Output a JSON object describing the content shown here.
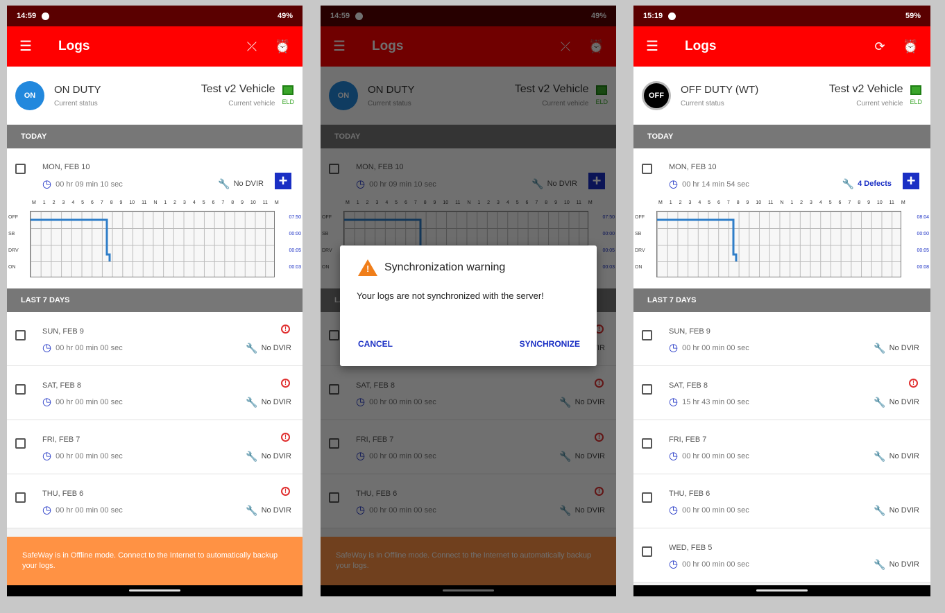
{
  "screens": [
    {
      "status_bar": {
        "time": "14:59",
        "battery": "49%"
      },
      "toolbar": {
        "title": "Logs",
        "icons": [
          "menu-icon",
          "sync-off-icon",
          "alarm-icon"
        ]
      },
      "summary": {
        "status_code": "ON",
        "status": "ON DUTY",
        "status_caption": "Current status",
        "vehicle": "Test v2 Vehicle",
        "vehicle_caption": "Current vehicle",
        "eld": "ELD"
      },
      "today_header": "TODAY",
      "today": {
        "date": "MON, FEB 10",
        "duration": "00 hr 09 min 10 sec",
        "dvir": "No DVIR",
        "hours": [
          "M",
          "1",
          "2",
          "3",
          "4",
          "5",
          "6",
          "7",
          "8",
          "9",
          "10",
          "11",
          "N",
          "1",
          "2",
          "3",
          "4",
          "5",
          "6",
          "7",
          "8",
          "9",
          "10",
          "11",
          "M"
        ],
        "statuses": [
          "OFF",
          "SB",
          "DRV",
          "ON"
        ],
        "totals": [
          "07:50",
          "00:00",
          "00:05",
          "00:03"
        ]
      },
      "last_header": "LAST 7 DAYS",
      "days": [
        {
          "date": "SUN, FEB 9",
          "duration": "00 hr 00 min 00 sec",
          "dvir": "No DVIR",
          "warning": "!"
        },
        {
          "date": "SAT, FEB 8",
          "duration": "00 hr 00 min 00 sec",
          "dvir": "No DVIR",
          "warning": "!"
        },
        {
          "date": "FRI, FEB 7",
          "duration": "00 hr 00 min 00 sec",
          "dvir": "No DVIR",
          "warning": "!"
        },
        {
          "date": "THU, FEB 6",
          "duration": "00 hr 00 min 00 sec",
          "dvir": "No DVIR",
          "warning": "!"
        }
      ],
      "banner": "SafeWay is in Offline mode. Connect to the Internet to automatically backup your logs."
    },
    {
      "status_bar": {
        "time": "14:59",
        "battery": "49%"
      },
      "toolbar": {
        "title": "Logs",
        "icons": [
          "menu-icon",
          "sync-off-icon",
          "alarm-icon"
        ]
      },
      "summary": {
        "status_code": "ON",
        "status": "ON DUTY",
        "status_caption": "Current status",
        "vehicle": "Test v2 Vehicle",
        "vehicle_caption": "Current vehicle",
        "eld": "ELD"
      },
      "today_header": "TODAY",
      "today": {
        "date": "MON, FEB 10",
        "duration": "00 hr 09 min 10 sec",
        "dvir": "No DVIR",
        "hours": [
          "M",
          "1",
          "2",
          "3",
          "4",
          "5",
          "6",
          "7",
          "8",
          "9",
          "10",
          "11",
          "N",
          "1",
          "2",
          "3",
          "4",
          "5",
          "6",
          "7",
          "8",
          "9",
          "10",
          "11",
          "M"
        ],
        "statuses": [
          "OFF",
          "SB",
          "DRV",
          "ON"
        ],
        "totals": [
          "07:50",
          "00:00",
          "00:05",
          "00:03"
        ]
      },
      "last_header": "LAST 7 DAYS",
      "days": [
        {
          "date": "SUN, FEB 9",
          "duration": "00 hr 00 min 00 sec",
          "dvir": "No DVIR",
          "warning": "!"
        },
        {
          "date": "SAT, FEB 8",
          "duration": "00 hr 00 min 00 sec",
          "dvir": "No DVIR",
          "warning": "!"
        },
        {
          "date": "FRI, FEB 7",
          "duration": "00 hr 00 min 00 sec",
          "dvir": "No DVIR",
          "warning": "!"
        },
        {
          "date": "THU, FEB 6",
          "duration": "00 hr 00 min 00 sec",
          "dvir": "No DVIR",
          "warning": "!"
        }
      ],
      "banner": "SafeWay is in Offline mode. Connect to the Internet to automatically backup your logs.",
      "dialog": {
        "title": "Synchronization warning",
        "message": "Your logs are not synchronized with the server!",
        "cancel": "CANCEL",
        "confirm": "SYNCHRONIZE"
      }
    },
    {
      "status_bar": {
        "time": "15:19",
        "battery": "59%"
      },
      "toolbar": {
        "title": "Logs",
        "icons": [
          "menu-icon",
          "sync-icon",
          "alarm-icon"
        ]
      },
      "summary": {
        "status_code": "OFF",
        "status": "OFF DUTY (WT)",
        "status_caption": "Current status",
        "vehicle": "Test v2 Vehicle",
        "vehicle_caption": "Current vehicle",
        "eld": "ELD"
      },
      "today_header": "TODAY",
      "today": {
        "date": "MON, FEB 10",
        "duration": "00 hr 14 min 54 sec",
        "dvir": "4 Defects",
        "hours": [
          "M",
          "1",
          "2",
          "3",
          "4",
          "5",
          "6",
          "7",
          "8",
          "9",
          "10",
          "11",
          "N",
          "1",
          "2",
          "3",
          "4",
          "5",
          "6",
          "7",
          "8",
          "9",
          "10",
          "11",
          "M"
        ],
        "statuses": [
          "OFF",
          "SB",
          "DRV",
          "ON"
        ],
        "totals": [
          "08:04",
          "00:00",
          "00:05",
          "00:08"
        ]
      },
      "last_header": "LAST 7 DAYS",
      "days": [
        {
          "date": "SUN, FEB 9",
          "duration": "00 hr 00 min 00 sec",
          "dvir": "No DVIR",
          "warning": ""
        },
        {
          "date": "SAT, FEB 8",
          "duration": "15 hr 43 min 00 sec",
          "dvir": "No DVIR",
          "warning": "!"
        },
        {
          "date": "FRI, FEB 7",
          "duration": "00 hr 00 min 00 sec",
          "dvir": "No DVIR",
          "warning": ""
        },
        {
          "date": "THU, FEB 6",
          "duration": "00 hr 00 min 00 sec",
          "dvir": "No DVIR",
          "warning": ""
        },
        {
          "date": "WED, FEB 5",
          "duration": "00 hr 00 min 00 sec",
          "dvir": "No DVIR",
          "warning": ""
        }
      ],
      "banner": ""
    }
  ],
  "colors": {
    "toolbar": "#ff0000",
    "status_bar": "#5a0000",
    "on_duty": "#2288dd",
    "accent": "#1a2fc4",
    "banner": "#ff9244",
    "warning": "#e03030",
    "eld": "#3aa52a"
  }
}
